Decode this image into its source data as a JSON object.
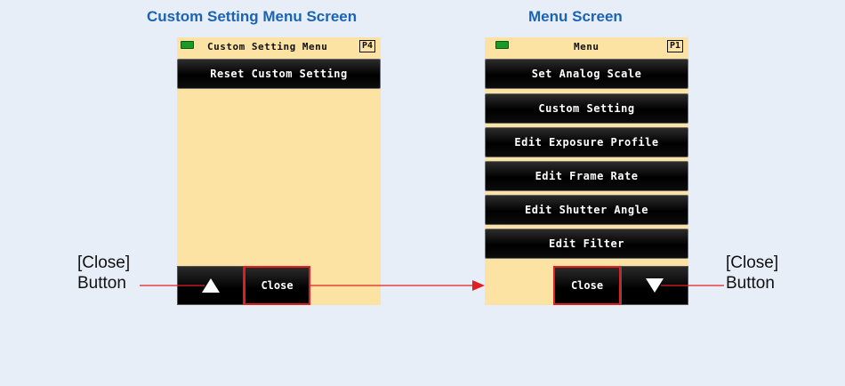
{
  "captions": {
    "left": "Custom Setting Menu Screen",
    "right": "Menu Screen"
  },
  "left_screen": {
    "title": "Custom Setting Menu",
    "page": "P4",
    "items": [
      "Reset Custom Setting"
    ],
    "close_label": "Close"
  },
  "right_screen": {
    "title": "Menu",
    "page": "P1",
    "items": [
      "Set Analog Scale",
      "Custom Setting",
      "Edit Exposure Profile",
      "Edit Frame Rate",
      "Edit Shutter Angle",
      "Edit Filter"
    ],
    "close_label": "Close"
  },
  "annotations": {
    "left_line1": "[Close]",
    "left_line2": "Button",
    "right_line1": "[Close]",
    "right_line2": "Button"
  },
  "colors": {
    "caption": "#1b63b5",
    "screen_bg": "#fde3a3",
    "highlight": "#e02020",
    "battery": "#1b9a2a"
  }
}
